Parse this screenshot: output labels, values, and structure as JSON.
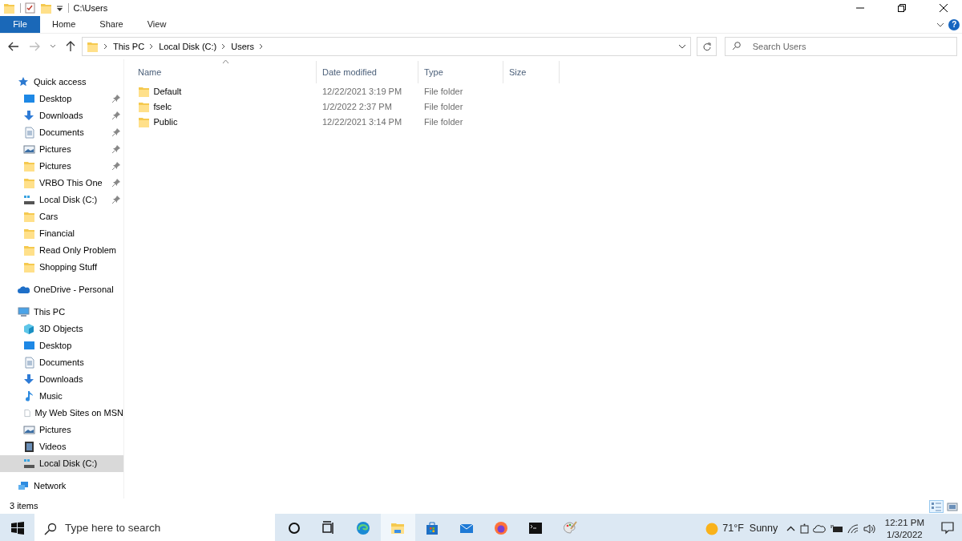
{
  "window": {
    "title": "C:\\Users",
    "help": "?"
  },
  "ribbon_tabs": [
    {
      "label": "File",
      "selected": true
    },
    {
      "label": "Home",
      "selected": false
    },
    {
      "label": "Share",
      "selected": false
    },
    {
      "label": "View",
      "selected": false
    }
  ],
  "breadcrumbs": [
    "This PC",
    "Local Disk (C:)",
    "Users"
  ],
  "search": {
    "placeholder": "Search Users"
  },
  "navigation": [
    {
      "label": "Quick access",
      "kind": "star",
      "selected": false,
      "pinned": false,
      "children": [
        {
          "label": "Desktop",
          "kind": "desktop",
          "selected": false,
          "pinned": true
        },
        {
          "label": "Downloads",
          "kind": "download",
          "selected": false,
          "pinned": true
        },
        {
          "label": "Documents",
          "kind": "document",
          "selected": false,
          "pinned": true
        },
        {
          "label": "Pictures",
          "kind": "pictures",
          "selected": false,
          "pinned": true
        },
        {
          "label": "Pictures",
          "kind": "folder",
          "selected": false,
          "pinned": true
        },
        {
          "label": "VRBO This One",
          "kind": "folder",
          "selected": false,
          "pinned": true
        },
        {
          "label": "Local Disk (C:)",
          "kind": "drive",
          "selected": false,
          "pinned": true
        },
        {
          "label": "Cars",
          "kind": "folder",
          "selected": false,
          "pinned": false
        },
        {
          "label": "Financial",
          "kind": "folder",
          "selected": false,
          "pinned": false
        },
        {
          "label": "Read Only Problem",
          "kind": "folder",
          "selected": false,
          "pinned": false
        },
        {
          "label": "Shopping Stuff",
          "kind": "folder",
          "selected": false,
          "pinned": false
        }
      ]
    },
    {
      "label": "OneDrive - Personal",
      "kind": "cloud",
      "selected": false,
      "pinned": false
    },
    {
      "label": "This PC",
      "kind": "pc",
      "selected": false,
      "pinned": false,
      "children": [
        {
          "label": "3D Objects",
          "kind": "cube",
          "selected": false,
          "pinned": false
        },
        {
          "label": "Desktop",
          "kind": "desktop",
          "selected": false,
          "pinned": false
        },
        {
          "label": "Documents",
          "kind": "document",
          "selected": false,
          "pinned": false
        },
        {
          "label": "Downloads",
          "kind": "download",
          "selected": false,
          "pinned": false
        },
        {
          "label": "Music",
          "kind": "music",
          "selected": false,
          "pinned": false
        },
        {
          "label": "My Web Sites on MSN",
          "kind": "file",
          "selected": false,
          "pinned": false
        },
        {
          "label": "Pictures",
          "kind": "pictures",
          "selected": false,
          "pinned": false
        },
        {
          "label": "Videos",
          "kind": "video",
          "selected": false,
          "pinned": false
        },
        {
          "label": "Local Disk (C:)",
          "kind": "drive",
          "selected": true,
          "pinned": false
        }
      ]
    },
    {
      "label": "Network",
      "kind": "network",
      "selected": false,
      "pinned": false
    }
  ],
  "file_list": {
    "columns": [
      "Name",
      "Date modified",
      "Type",
      "Size"
    ],
    "rows": [
      {
        "name": "Default",
        "date_modified": "12/22/2021 3:19 PM",
        "type": "File folder"
      },
      {
        "name": "fselc",
        "date_modified": "1/2/2022 2:37 PM",
        "type": "File folder"
      },
      {
        "name": "Public",
        "date_modified": "12/22/2021 3:14 PM",
        "type": "File folder"
      }
    ]
  },
  "status_bar": {
    "item_count": "3 items",
    "views": [
      {
        "kind": "details",
        "selected": true
      },
      {
        "kind": "tiles",
        "selected": false
      }
    ]
  },
  "taskbar": {
    "search_placeholder": "Type here to search",
    "apps": [
      {
        "kind": "cortana",
        "selected": false
      },
      {
        "kind": "taskview",
        "selected": false
      },
      {
        "kind": "edge",
        "selected": false
      },
      {
        "kind": "explorer",
        "selected": true
      },
      {
        "kind": "store",
        "selected": false
      },
      {
        "kind": "mail",
        "selected": false
      },
      {
        "kind": "firefox",
        "selected": false
      },
      {
        "kind": "terminal",
        "selected": false
      },
      {
        "kind": "paint",
        "selected": false
      }
    ],
    "weather": "71°F  Sunny",
    "time": "12:21 PM",
    "date": "1/3/2022"
  }
}
